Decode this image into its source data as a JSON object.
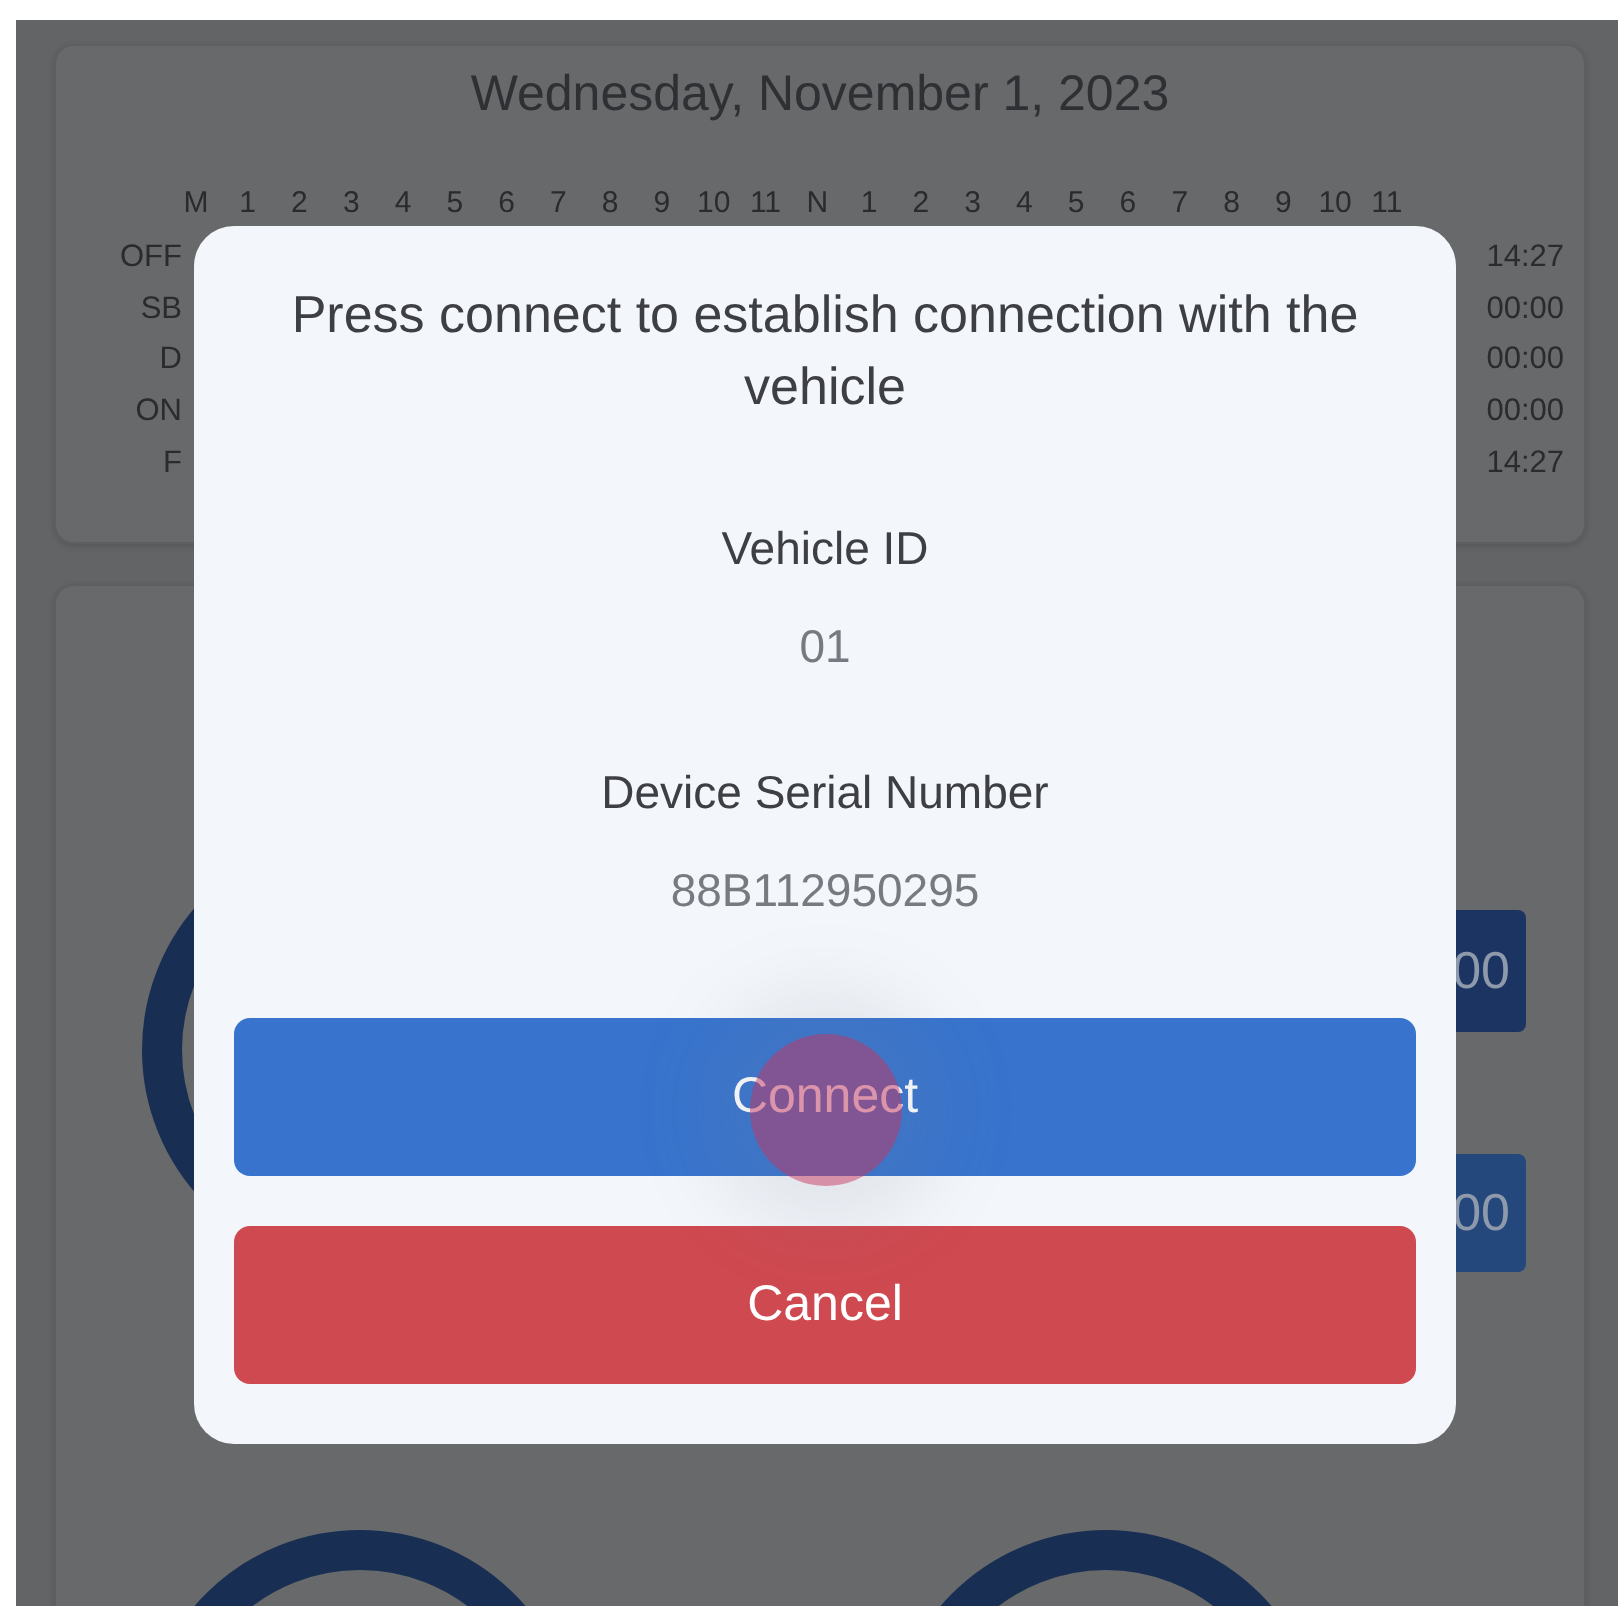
{
  "date": "Wednesday, November 1, 2023",
  "hours": [
    "M",
    "1",
    "2",
    "3",
    "4",
    "5",
    "6",
    "7",
    "8",
    "9",
    "10",
    "11",
    "N",
    "1",
    "2",
    "3",
    "4",
    "5",
    "6",
    "7",
    "8",
    "9",
    "10",
    "11"
  ],
  "rows": [
    {
      "label": "OFF",
      "total": "14:27"
    },
    {
      "label": "SB",
      "total": "00:00"
    },
    {
      "label": "D",
      "total": "00:00"
    },
    {
      "label": "ON",
      "total": "00:00"
    },
    {
      "label": "F",
      "total": "14:27"
    }
  ],
  "side_values": [
    "00",
    "00"
  ],
  "dialog": {
    "title": "Press connect to establish connection with the vehicle",
    "fields": [
      {
        "label": "Vehicle ID",
        "value": "01"
      },
      {
        "label": "Device Serial Number",
        "value": "88B112950295"
      }
    ],
    "buttons": [
      {
        "kind": "primary",
        "label": "Connect"
      },
      {
        "kind": "danger",
        "label": "Cancel"
      }
    ]
  }
}
